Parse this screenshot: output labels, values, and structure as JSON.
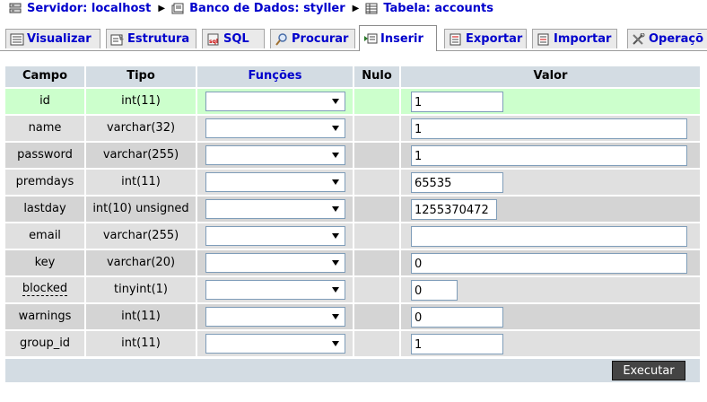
{
  "breadcrumb": {
    "server": "Servidor: localhost",
    "database": "Banco de Dados: styller",
    "table": "Tabela: accounts"
  },
  "tabs": [
    {
      "label": "Visualizar",
      "icon": "browse-icon"
    },
    {
      "label": "Estrutura",
      "icon": "structure-icon"
    },
    {
      "label": "SQL",
      "icon": "sql-icon"
    },
    {
      "label": "Procurar",
      "icon": "search-icon"
    },
    {
      "label": "Inserir",
      "icon": "insert-icon",
      "active": true
    },
    {
      "label": "Exportar",
      "icon": "export-icon"
    },
    {
      "label": "Importar",
      "icon": "import-icon"
    },
    {
      "label": "Operaçõ",
      "icon": "operations-icon"
    }
  ],
  "headers": {
    "campo": "Campo",
    "tipo": "Tipo",
    "funcoes": "Funções",
    "nulo": "Nulo",
    "valor": "Valor"
  },
  "fields": [
    {
      "name": "id",
      "type": "int(11)",
      "value": "1"
    },
    {
      "name": "name",
      "type": "varchar(32)",
      "value": "1"
    },
    {
      "name": "password",
      "type": "varchar(255)",
      "value": "1"
    },
    {
      "name": "premdays",
      "type": "int(11)",
      "value": "65535"
    },
    {
      "name": "lastday",
      "type": "int(10) unsigned",
      "value": "1255370472"
    },
    {
      "name": "email",
      "type": "varchar(255)",
      "value": ""
    },
    {
      "name": "key",
      "type": "varchar(20)",
      "value": "0"
    },
    {
      "name": "blocked",
      "type": "tinyint(1)",
      "value": "0"
    },
    {
      "name": "warnings",
      "type": "int(11)",
      "value": "0"
    },
    {
      "name": "group_id",
      "type": "int(11)",
      "value": "1"
    }
  ],
  "submit_label": "Executar",
  "colors": {
    "link": "#0000cc",
    "header_bg": "#d3dce3",
    "row_highlight": "#ccffcc",
    "button_bg": "#444444"
  }
}
